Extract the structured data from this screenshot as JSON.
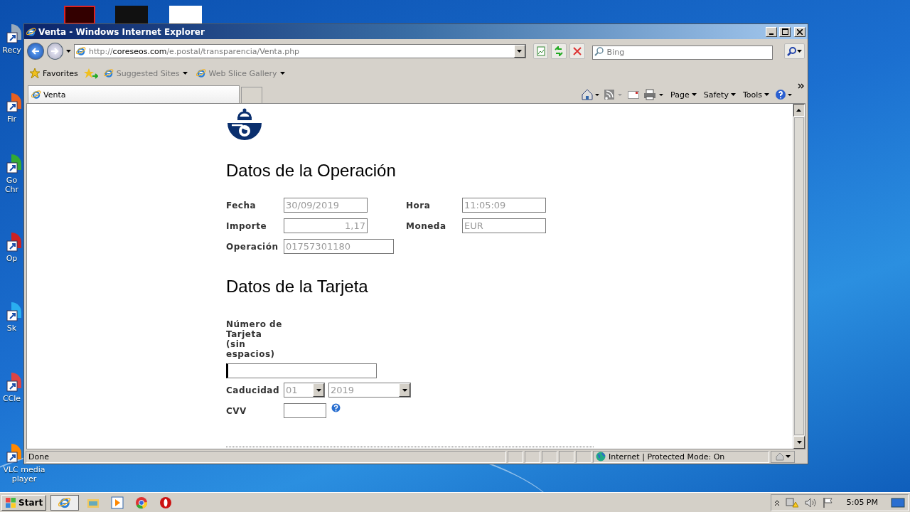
{
  "desktop": {
    "icons": [
      {
        "label": "Recy",
        "kind": "bin"
      },
      {
        "label": "Fir",
        "kind": "firefox"
      },
      {
        "label": "Go Chr",
        "kind": "chrome"
      },
      {
        "label": "Op",
        "kind": "opera"
      },
      {
        "label": "Sk",
        "kind": "skype"
      },
      {
        "label": "CCle",
        "kind": "ccleaner"
      },
      {
        "label": "VLC media player",
        "kind": "vlc"
      }
    ]
  },
  "window": {
    "title": "Venta - Windows Internet Explorer",
    "address": {
      "scheme": "http://",
      "domain": "coreseos.com",
      "path": "/e.postal/transparencia/Venta.php"
    },
    "search": {
      "placeholder": "Bing"
    },
    "favorites_bar": {
      "favorites": "Favorites",
      "items": [
        "Suggested Sites",
        "Web Slice Gallery"
      ]
    },
    "tabs": [
      {
        "label": "Venta",
        "selected": true
      }
    ],
    "command_bar": [
      "Page",
      "Safety",
      "Tools"
    ],
    "status_bar": {
      "status": "Done",
      "zone": "Internet | Protected Mode: On"
    }
  },
  "page": {
    "section_1": {
      "heading": "Datos de la Operación",
      "fields": [
        {
          "label": "Fecha",
          "value": "30/09/2019",
          "kind": "text",
          "disabled": true
        },
        {
          "label": "Hora",
          "value": "11:05:09",
          "kind": "text",
          "disabled": true
        },
        {
          "label": "Importe",
          "value": "1,17",
          "kind": "amount",
          "disabled": true
        },
        {
          "label": "Moneda",
          "value": "EUR",
          "kind": "text",
          "disabled": true
        },
        {
          "label": "Operación",
          "value": "01757301180",
          "kind": "long",
          "disabled": true
        }
      ]
    },
    "section_2": {
      "heading": "Datos de la Tarjeta",
      "card_number": {
        "label": "Número de Tarjeta (sin espacios)",
        "focused": true
      },
      "expiry": {
        "label": "Caducidad",
        "month": "01",
        "year": "2019",
        "disabled": true
      },
      "cvv": {
        "label": "CVV"
      }
    }
  },
  "taskbar": {
    "start": "Start",
    "clock": "5:05 PM"
  }
}
